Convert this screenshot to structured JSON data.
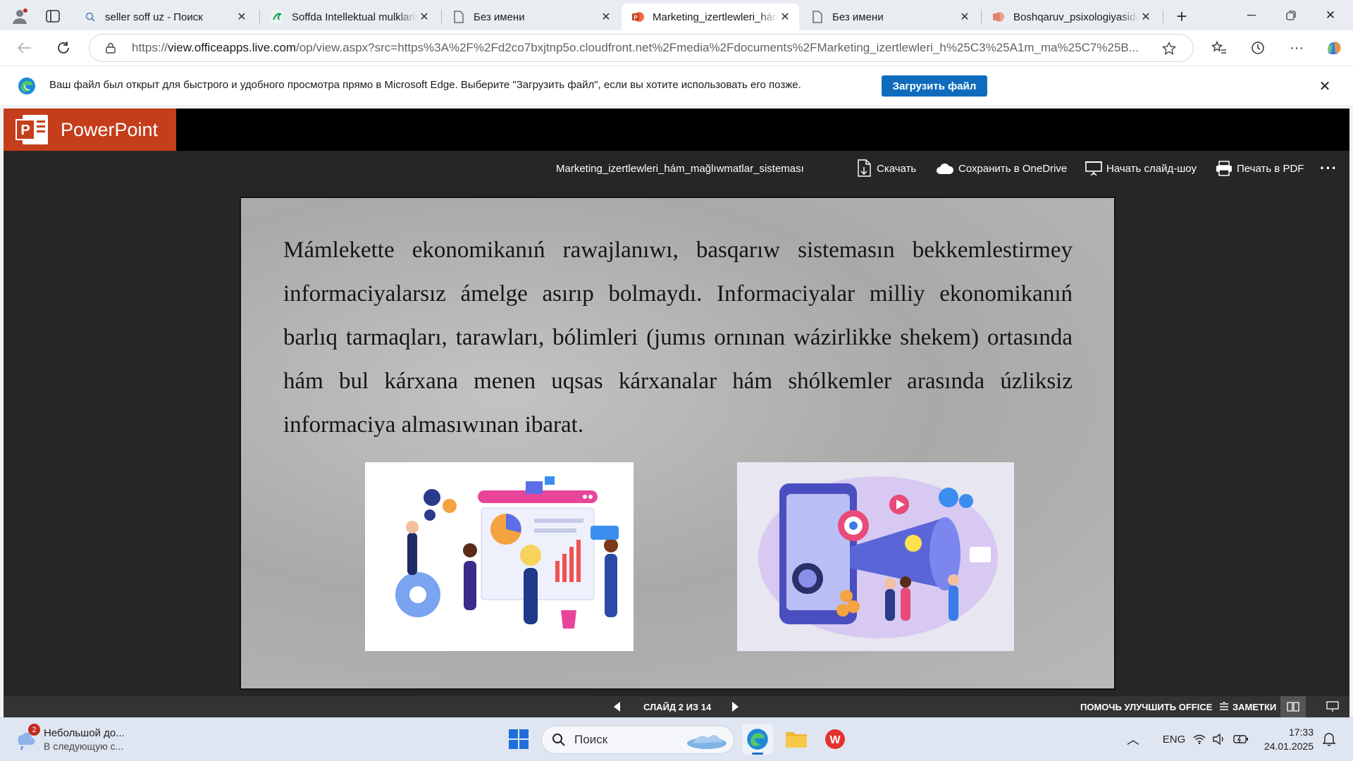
{
  "browser": {
    "tabs": [
      {
        "title": "seller soff uz - Поиск",
        "active": false
      },
      {
        "title": "Soffda Intellektual mulklarini sotish",
        "active": false
      },
      {
        "title": "Без имени",
        "active": false
      },
      {
        "title": "Marketing_izertlewleri_hám_mağlıwmatlar_sistemasi",
        "active": true
      },
      {
        "title": "Без имени",
        "active": false
      },
      {
        "title": "Boshqaruv_psixologiyasida",
        "active": false
      }
    ],
    "url_prefix": "https://",
    "url_domain": "view.officeapps.live.com",
    "url_rest": "/op/view.aspx?src=https%3A%2F%2Fd2co7bxjtnp5o.cloudfront.net%2Fmedia%2Fdocuments%2FMarketing_izertlewleri_h%25C3%25A1m_ma%25C7%25B..."
  },
  "infobar": {
    "message": "Ваш файл был открыт для быстрого и удобного просмотра прямо в Microsoft Edge. Выберите \"Загрузить файл\", если вы хотите использовать его позже.",
    "button": "Загрузить файл"
  },
  "powerpoint": {
    "app_name": "PowerPoint",
    "doc_title": "Marketing_izertlewleri_hám_mağlıwmatlar_sisteması",
    "toolbar": {
      "download": "Скачать",
      "onedrive": "Сохранить в OneDrive",
      "slideshow": "Начать слайд-шоу",
      "print": "Печать в PDF"
    },
    "slide_text": "Mámlekette ekonomikanıń rawajlanıwı, basqarıw sistemasın bekkemlestirmey informaciyalarsız ámelge asırıp bolmaydı. Informaciyalar milliy ekonomikanıń barlıq tarmaqları, tarawları, bólimleri (jumıs ornınan wázirlikke shekem) ortasında hám bul kárxana menen uqsas kárxanalar hám shólkemler arasında úzliksiz informaciya almasıwınan ibarat.",
    "status": {
      "slide_counter": "СЛАЙД 2 ИЗ 14",
      "help": "ПОМОЧЬ УЛУЧШИТЬ OFFICE",
      "notes": "ЗАМЕТКИ"
    }
  },
  "taskbar": {
    "weather_badge": "2",
    "weather_title": "Небольшой до...",
    "weather_sub": "В следующую с...",
    "search_placeholder": "Поиск",
    "lang": "ENG",
    "time": "17:33",
    "date": "24.01.2025"
  },
  "colors": {
    "ppt_brand": "#c43e1c",
    "edge_blue": "#0f6cbd",
    "viewer_bg": "#262626"
  }
}
